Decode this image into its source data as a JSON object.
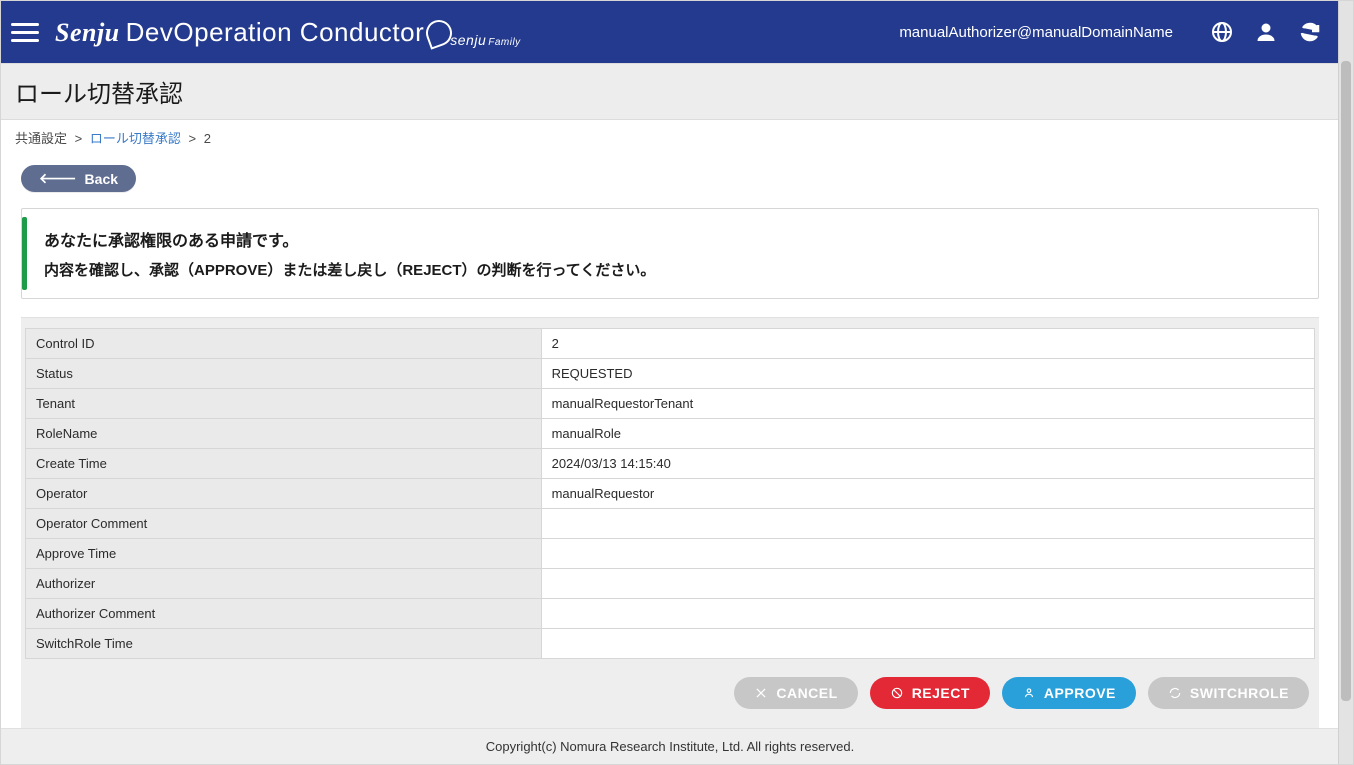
{
  "header": {
    "brand_main": "Senju",
    "brand_tail": "DevOperation Conductor",
    "brand_sub": "senju",
    "brand_fam": "Family",
    "user_label": "manualAuthorizer@manualDomainName"
  },
  "title": "ロール切替承認",
  "breadcrumbs": {
    "root": "共通設定",
    "mid": "ロール切替承認",
    "leaf": "2"
  },
  "back_button": {
    "label": "Back"
  },
  "notice": {
    "title": "あなたに承認権限のある申請です。",
    "body": "内容を確認し、承認（APPROVE）または差し戻し（REJECT）の判断を行ってください。"
  },
  "fields": [
    {
      "label": "Control ID",
      "value": "2"
    },
    {
      "label": "Status",
      "value": "REQUESTED"
    },
    {
      "label": "Tenant",
      "value": "manualRequestorTenant"
    },
    {
      "label": "RoleName",
      "value": "manualRole"
    },
    {
      "label": "Create Time",
      "value": "2024/03/13 14:15:40"
    },
    {
      "label": "Operator",
      "value": "manualRequestor"
    },
    {
      "label": "Operator Comment",
      "value": ""
    },
    {
      "label": "Approve Time",
      "value": ""
    },
    {
      "label": "Authorizer",
      "value": ""
    },
    {
      "label": "Authorizer Comment",
      "value": ""
    },
    {
      "label": "SwitchRole Time",
      "value": ""
    }
  ],
  "actions": {
    "cancel": "CANCEL",
    "reject": "REJECT",
    "approve": "APPROVE",
    "switchrole": "SWITCHROLE"
  },
  "footer": "Copyright(c) Nomura Research Institute, Ltd. All rights reserved."
}
